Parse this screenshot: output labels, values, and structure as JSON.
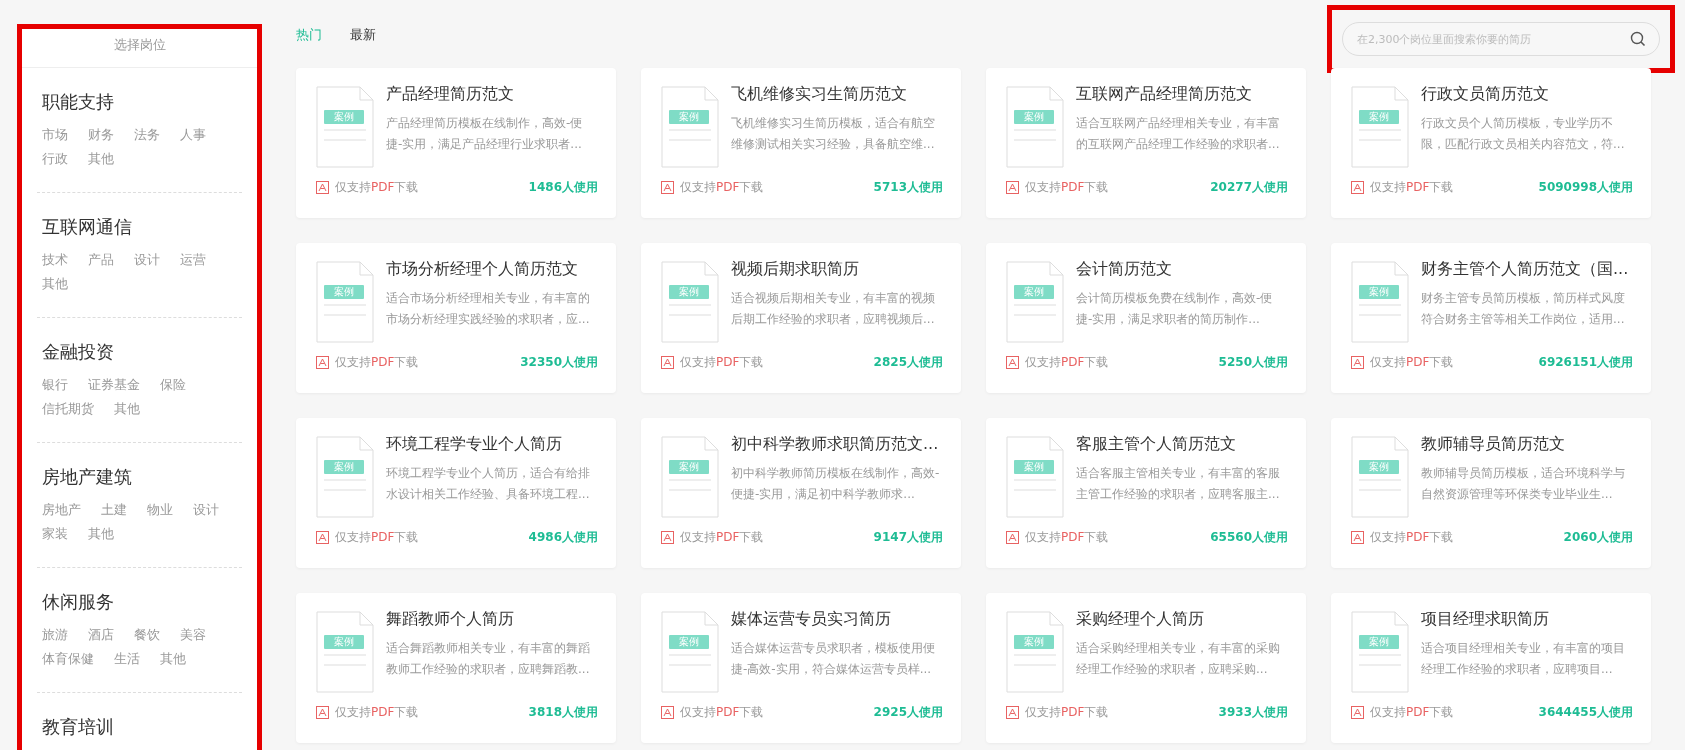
{
  "sidebar": {
    "title": "选择岗位",
    "groups": [
      {
        "name": "职能支持",
        "tags": [
          "市场",
          "财务",
          "法务",
          "人事",
          "行政",
          "其他"
        ]
      },
      {
        "name": "互联网通信",
        "tags": [
          "技术",
          "产品",
          "设计",
          "运营",
          "其他"
        ]
      },
      {
        "name": "金融投资",
        "tags": [
          "银行",
          "证券基金",
          "保险",
          "信托期货",
          "其他"
        ]
      },
      {
        "name": "房地产建筑",
        "tags": [
          "房地产",
          "土建",
          "物业",
          "设计",
          "家装",
          "其他"
        ]
      },
      {
        "name": "休闲服务",
        "tags": [
          "旅游",
          "酒店",
          "餐饮",
          "美容",
          "体育保健",
          "生活",
          "其他"
        ]
      },
      {
        "name": "教育培训"
      }
    ]
  },
  "tabs": [
    {
      "label": "热门",
      "selected": true
    },
    {
      "label": "最新",
      "selected": false
    }
  ],
  "search": {
    "placeholder": "在2,300个岗位里面搜索你要的简历"
  },
  "cards": [
    {
      "badge": "案例",
      "title": "产品经理简历范文",
      "description": "产品经理简历模板在线制作，高效-便捷-实用，满足产品经理行业求职者...",
      "note": [
        "仅支持",
        "PDF",
        "下载"
      ],
      "users": "1486人使用"
    },
    {
      "badge": "案例",
      "title": "飞机维修实习生简历范文",
      "description": "飞机维修实习生简历模板，适合有航空维修测试相关实习经验，具备航空维...",
      "note": [
        "仅支持",
        "PDF",
        "下载"
      ],
      "users": "5713人使用"
    },
    {
      "badge": "案例",
      "title": "互联网产品经理简历范文",
      "description": "适合互联网产品经理相关专业，有丰富的互联网产品经理工作经验的求职者...",
      "note": [
        "仅支持",
        "PDF",
        "下载"
      ],
      "users": "20277人使用"
    },
    {
      "badge": "案例",
      "title": "行政文员简历范文",
      "description": "行政文员个人简历模板，专业学历不限，匹配行政文员相关内容范文，符...",
      "note": [
        "仅支持",
        "PDF",
        "下载"
      ],
      "users": "5090998人使用"
    },
    {
      "badge": "案例",
      "title": "市场分析经理个人简历范文",
      "description": "适合市场分析经理相关专业，有丰富的市场分析经理实践经验的求职者，应...",
      "note": [
        "仅支持",
        "PDF",
        "下载"
      ],
      "users": "32350人使用"
    },
    {
      "badge": "案例",
      "title": "视频后期求职简历",
      "description": "适合视频后期相关专业，有丰富的视频后期工作经验的求职者，应聘视频后...",
      "note": [
        "仅支持",
        "PDF",
        "下载"
      ],
      "users": "2825人使用"
    },
    {
      "badge": "案例",
      "title": "会计简历范文",
      "description": "会计简历模板免费在线制作，高效-便捷-实用，满足求职者的简历制作...",
      "note": [
        "仅支持",
        "PDF",
        "下载"
      ],
      "users": "5250人使用"
    },
    {
      "badge": "案例",
      "title": "财务主管个人简历范文（国...",
      "description": "财务主管专员简历模板，简历样式风度符合财务主管等相关工作岗位，适用...",
      "note": [
        "仅支持",
        "PDF",
        "下载"
      ],
      "users": "6926151人使用"
    },
    {
      "badge": "案例",
      "title": "环境工程学专业个人简历",
      "description": "环境工程学专业个人简历，适合有给排水设计相关工作经验、具备环境工程...",
      "note": [
        "仅支持",
        "PDF",
        "下载"
      ],
      "users": "4986人使用"
    },
    {
      "badge": "案例",
      "title": "初中科学教师求职简历范文...",
      "description": "初中科学教师简历模板在线制作，高效-便捷-实用，满足初中科学教师求...",
      "note": [
        "仅支持",
        "PDF",
        "下载"
      ],
      "users": "9147人使用"
    },
    {
      "badge": "案例",
      "title": "客服主管个人简历范文",
      "description": "适合客服主管相关专业，有丰富的客服主管工作经验的求职者，应聘客服主...",
      "note": [
        "仅支持",
        "PDF",
        "下载"
      ],
      "users": "65560人使用"
    },
    {
      "badge": "案例",
      "title": "教师辅导员简历范文",
      "description": "教师辅导员简历模板，适合环境科学与自然资源管理等环保类专业毕业生...",
      "note": [
        "仅支持",
        "PDF",
        "下载"
      ],
      "users": "2060人使用"
    },
    {
      "badge": "案例",
      "title": "舞蹈教师个人简历",
      "description": "适合舞蹈教师相关专业，有丰富的舞蹈教师工作经验的求职者，应聘舞蹈教...",
      "note": [
        "仅支持",
        "PDF",
        "下载"
      ],
      "users": "3818人使用"
    },
    {
      "badge": "案例",
      "title": "媒体运营专员实习简历",
      "description": "适合媒体运营专员求职者，模板使用便捷-高效-实用，符合媒体运营专员样...",
      "note": [
        "仅支持",
        "PDF",
        "下载"
      ],
      "users": "2925人使用"
    },
    {
      "badge": "案例",
      "title": "采购经理个人简历",
      "description": "适合采购经理相关专业，有丰富的采购经理工作经验的求职者，应聘采购...",
      "note": [
        "仅支持",
        "PDF",
        "下载"
      ],
      "users": "3933人使用"
    },
    {
      "badge": "案例",
      "title": "项目经理求职简历",
      "description": "适合项目经理相关专业，有丰富的项目经理工作经验的求职者，应聘项目...",
      "note": [
        "仅支持",
        "PDF",
        "下载"
      ],
      "users": "3644455人使用"
    }
  ]
}
